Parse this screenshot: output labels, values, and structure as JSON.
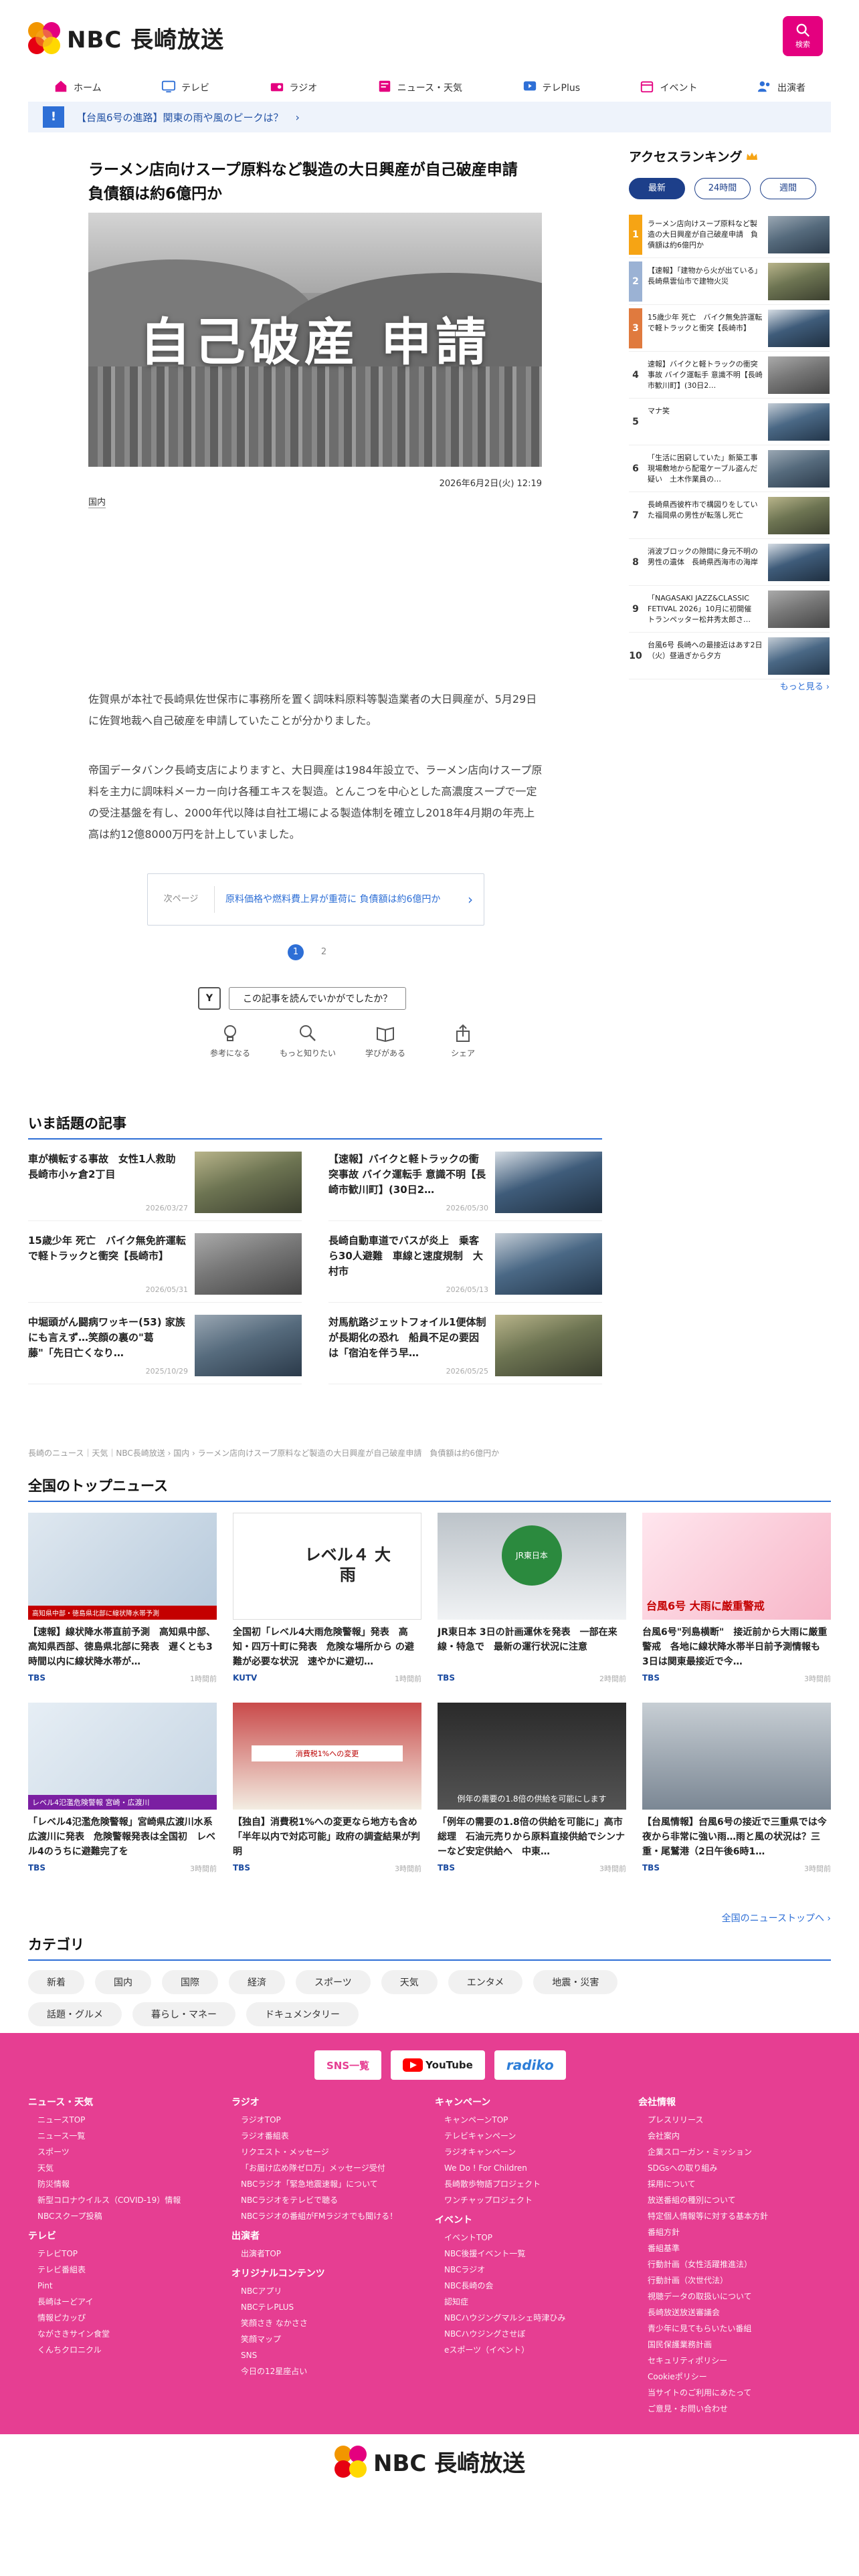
{
  "header": {
    "logo_text": "NBC 長崎放送",
    "search_label": "検索"
  },
  "gnav": [
    {
      "icon": "home-icon",
      "label": "ホーム"
    },
    {
      "icon": "tv-icon",
      "label": "テレビ"
    },
    {
      "icon": "radio-icon",
      "label": "ラジオ"
    },
    {
      "icon": "news-icon",
      "label": "ニュース・天気"
    },
    {
      "icon": "teleplus-icon",
      "label": "テレPlus"
    },
    {
      "icon": "calendar-icon",
      "label": "イベント"
    },
    {
      "icon": "people-icon",
      "label": "出演者"
    }
  ],
  "ticker": {
    "badge": "!",
    "text": "【台風6号の進路】関東の雨や風のピークは？"
  },
  "article": {
    "title": "ラーメン店向けスープ原料など製造の大日興産が自己破産申請　負債額は約6億円か",
    "image_caption": "自己破産 申請",
    "date": "2026年6月2日(火) 12:19",
    "category": "国内",
    "paragraphs": [
      "佐賀県が本社で長崎県佐世保市に事務所を置く調味料原料等製造業者の大日興産が、5月29日に佐賀地裁へ自己破産を申請していたことが分かりました。",
      "帝国データバンク長崎支店によりますと、大日興産は1984年設立で、ラーメン店向けスープ原料を主力に調味料メーカー向け各種エキスを製造。とんこつを中心とした高濃度スープで一定の受注基盤を有し、2000年代以降は自社工場による製造体制を確立し2018年4月期の年売上高は約12億8000万円を計上していました。"
    ],
    "next_label": "次ページ",
    "next_title": "原料価格や燃料費上昇が重荷に 負債額は約6億円か",
    "pages": [
      "1",
      "2"
    ],
    "reaction_q": "この記事を読んでいかがでしたか？",
    "reactions": [
      {
        "icon": "bulb-icon",
        "label": "参考になる"
      },
      {
        "icon": "magnifier-icon",
        "label": "もっと知りたい"
      },
      {
        "icon": "book-icon",
        "label": "学びがある"
      },
      {
        "icon": "share-icon",
        "label": "シェア"
      }
    ]
  },
  "hot": {
    "heading": "いま話題の記事",
    "items": [
      {
        "title": "車が横転する事故　女性1人救助　長崎市小ヶ倉2丁目",
        "date": "2026/03/27"
      },
      {
        "title": "【速報】バイクと軽トラックの衝突事故 バイク運転手 意識不明【長崎市歓川町】(30日2…",
        "date": "2026/05/30"
      },
      {
        "title": "15歳少年 死亡　バイク無免許運転で軽トラックと衝突【長崎市】",
        "date": "2026/05/31"
      },
      {
        "title": "長崎自動車道でバスが炎上　乗客ら30人避難　車線と速度規制　大村市",
        "date": "2026/05/13"
      },
      {
        "title": "中堀頭がん闘病ワッキー(53) 家族にも言えず…笑顔の裏の\"葛藤\"「先日亡くなり…",
        "date": "2025/10/29"
      },
      {
        "title": "対馬航路ジェットフォイル1便体制が長期化の恐れ　船員不足の要因は「宿泊を伴う早…",
        "date": "2026/05/25"
      }
    ]
  },
  "breadcrumb": "長崎のニュース｜天気｜NBC長崎放送 › 国内 › ラーメン店向けスープ原料など製造の大日興産が自己破産申請　負債額は約6億円か",
  "top_news": {
    "heading": "全国のトップニュース",
    "items": [
      {
        "title": "【速報】線状降水帯直前予測　高知県中部、高知県西部、徳島県北部に発表　遅くとも3時間以内に線状降水帯が…",
        "net": "TBS",
        "time": "1時間前",
        "img_label": "高知県中部・徳島県北部に線状降水帯予測"
      },
      {
        "title": "全国初「レベル4大雨危険警報」発表　高知・四万十町に発表　危険な場所から の避難が必要な状況　速やかに避切…",
        "net": "KUTV",
        "time": "1時間前",
        "img_label": "レベル４ 大雨"
      },
      {
        "title": "JR東日本 3日の計画運休を発表　一部在来線・特急で　最新の運行状況に注意",
        "net": "TBS",
        "time": "2時間前",
        "img_label": "JR東日本"
      },
      {
        "title": "台風6号\"列島横断\"　接近前から大雨に厳重警戒　各地に線状降水帯半日前予測情報も　3日は関東最接近で今…",
        "net": "TBS",
        "time": "3時間前",
        "img_label": "台風6号 大雨に厳重警戒"
      },
      {
        "title": "「レベル4氾濫危険警報」宮崎県広渡川水系広渡川に発表　危険警報発表は全国初　レベル4のうちに避難完了を",
        "net": "TBS",
        "time": "3時間前",
        "img_label": "レベル4氾濫危険警報 宮崎・広渡川"
      },
      {
        "title": "【独自】消費税1%への変更なら地方も含め「半年以内で対応可能」政府の調査結果が判明",
        "net": "TBS",
        "time": "3時間前",
        "img_label": "消費税1%への変更"
      },
      {
        "title": "「例年の需要の1.8倍の供給を可能に」高市総理　石油元売りから原料直接供給でシンナーなど安定供給へ　中東…",
        "net": "TBS",
        "time": "3時間前",
        "img_label": "例年の需要の1.8倍の供給を可能にします"
      },
      {
        "title": "【台風情報】台風6号の接近で三重県では今夜から非常に強い雨…雨と風の状況は？三重・尾鷲港（2日午後6時1…",
        "net": "TBS",
        "time": "3時間前",
        "img_label": ""
      }
    ],
    "more": "全国のニューストップへ ›"
  },
  "categories": {
    "heading": "カテゴリ",
    "items": [
      "新着",
      "国内",
      "国際",
      "経済",
      "スポーツ",
      "天気",
      "エンタメ",
      "地震・災害",
      "話題・グルメ",
      "暮らし・マネー",
      "ドキュメンタリー"
    ]
  },
  "ranking": {
    "heading": "アクセスランキング",
    "tabs": [
      "最新",
      "24時間",
      "週間"
    ],
    "items": [
      {
        "num": "1",
        "title": "ラーメン店向けスープ原料など製造の大日興産が自己破産申請　負債額は約6億円か"
      },
      {
        "num": "2",
        "title": "【速報】「建物から火が出ている」長崎県雲仙市で建物火災"
      },
      {
        "num": "3",
        "title": "15歳少年 死亡　バイク無免許運転で軽トラックと衝突【長崎市】"
      },
      {
        "num": "4",
        "title": "速報】バイクと軽トラックの衝突事故 バイク運転手 意識不明【長崎市歓川町】(30日2…"
      },
      {
        "num": "5",
        "title": "マナ笑"
      },
      {
        "num": "6",
        "title": "「生活に困窮していた」新築工事現場敷地から配電ケーブル盗んだ疑い　土木作業員の…"
      },
      {
        "num": "7",
        "title": "長崎県西彼杵市で構図りをしていた福岡県の男性が転落し死亡"
      },
      {
        "num": "8",
        "title": "消波ブロックの隙間に身元不明の男性の遺体　長崎県西海市の海岸"
      },
      {
        "num": "9",
        "title": "「NAGASAKI JAZZ&CLASSIC FETIVAL 2026」10月に初開催　トランペッター松井秀太郎さ…"
      },
      {
        "num": "10",
        "title": "台風6号 長崎への最接近はあす2日（火）昼過ぎから夕方"
      }
    ],
    "more": "もっと見る ›"
  },
  "footer": {
    "sns": [
      "SNS一覧",
      "YouTube",
      "radiko"
    ],
    "cols": [
      {
        "heading": "ニュース・天気",
        "links": [
          "ニュースTOP",
          "ニュース一覧",
          "スポーツ",
          "天気",
          "防災情報",
          "新型コロナウイルス（COVID-19）情報",
          "NBCスクープ投稿"
        ]
      },
      {
        "heading": "テレビ",
        "links": [
          "テレビTOP",
          "テレビ番組表",
          "Pint",
          "長崎はーどアイ",
          "情報ピカッぴ",
          "ながさきサイン食堂",
          "くんちクロニクル"
        ]
      },
      {
        "heading": "ラジオ",
        "links": [
          "ラジオTOP",
          "ラジオ番組表",
          "リクエスト・メッセージ",
          "「お届け広め隊ゼロ万」メッセージ受付",
          "NBCラジオ「緊急地震速報」について",
          "NBCラジオをテレビで聴る",
          "NBCラジオの番組がFMラジオでも聞ける！"
        ]
      },
      {
        "heading": "出演者",
        "links": [
          "出演者TOP"
        ]
      },
      {
        "heading": "オリジナルコンテンツ",
        "links": [
          "NBCアプリ",
          "NBCテレPLUS",
          "笑顔さき なかささ",
          "笑顔マップ",
          "SNS",
          "今日の12星座占い"
        ]
      },
      {
        "heading": "キャンペーン",
        "links": [
          "キャンペーンTOP",
          "テレビキャンペーン",
          "ラジオキャンペーン",
          "We Do ! For Children",
          "長崎散歩物語プロジェクト",
          "ワンチャップロジェクト"
        ]
      },
      {
        "heading": "イベント",
        "links": [
          "イベントTOP",
          "NBC後援イベント一覧",
          "NBCラジオ",
          "NBC長崎の会",
          "認知症",
          "NBCハウジングマルシェ時津ひみ",
          "NBCハウジングさせぼ",
          "eスポーツ（イベント）"
        ]
      },
      {
        "heading": "会社情報",
        "links": [
          "プレスリリース",
          "会社案内",
          "企業スローガン・ミッション",
          "SDGsへの取り組み",
          "採用について",
          "放送番組の種別について",
          "特定個人情報等に対する基本方針",
          "番組方針",
          "番組基準",
          "行動計画（女性活躍推進法）",
          "行動計画（次世代法）",
          "視聴データの取扱いについて",
          "長崎放送放送審議会",
          "青少年に見てもらいたい番組",
          "国民保護業務計画",
          "セキュリティポリシー",
          "Cookieポリシー",
          "当サイトのご利用にあたって",
          "ご意見・お問い合わせ"
        ]
      }
    ]
  },
  "colors": {
    "brand_pink": "#e4007f",
    "link_blue": "#2e6fd6",
    "rank_navy": "#1d3f8a",
    "footer_pink": "#e63e92"
  }
}
